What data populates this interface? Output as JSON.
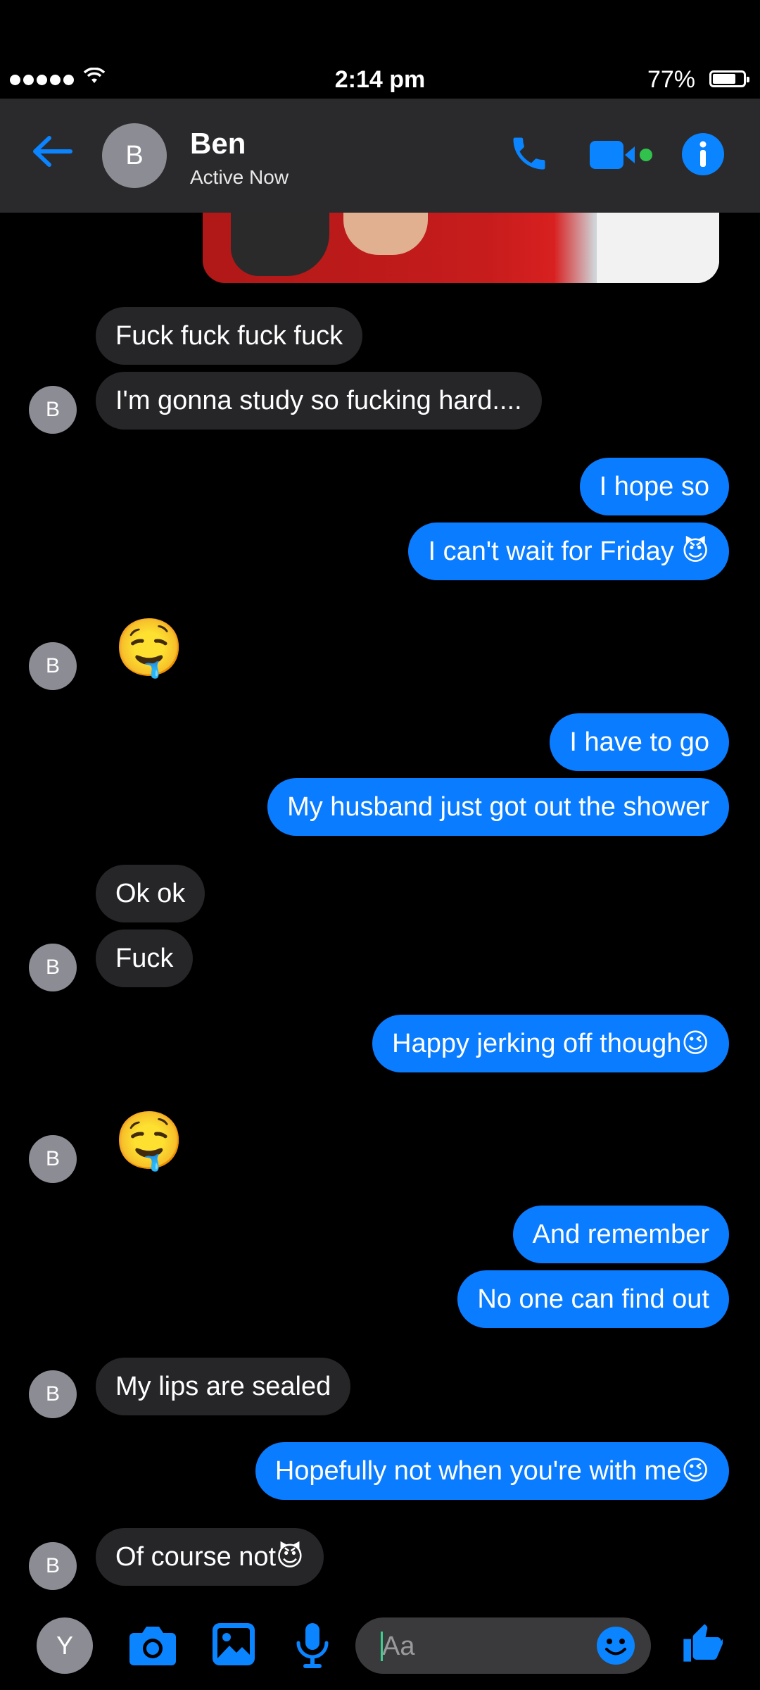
{
  "status_bar": {
    "time": "2:14 pm",
    "battery_percent": "77%",
    "battery_level": 0.77,
    "signal_bars": 5
  },
  "header": {
    "avatar_initial": "B",
    "contact_name": "Ben",
    "contact_status": "Active Now"
  },
  "colors": {
    "background": "#000000",
    "header_bg": "#2a2a2c",
    "accent_blue": "#0a7cff",
    "incoming_bubble": "#262629",
    "avatar_gray": "#8c8c94",
    "online_green": "#31c24d"
  },
  "messages": [
    {
      "from": "contact",
      "text": "Fuck fuck fuck fuck"
    },
    {
      "from": "contact",
      "text": "I'm gonna study so fucking hard...."
    },
    {
      "from": "me",
      "text": "I hope so"
    },
    {
      "from": "me",
      "text": "I can't wait for Friday 😈"
    },
    {
      "from": "contact",
      "text": "🤤"
    },
    {
      "from": "me",
      "text": "I have to go"
    },
    {
      "from": "me",
      "text": "My husband just got out the shower"
    },
    {
      "from": "contact",
      "text": "Ok ok"
    },
    {
      "from": "contact",
      "text": "Fuck"
    },
    {
      "from": "me",
      "text": "Happy jerking off though😉"
    },
    {
      "from": "contact",
      "text": "🤤"
    },
    {
      "from": "me",
      "text": "And remember"
    },
    {
      "from": "me",
      "text": "No one can find out"
    },
    {
      "from": "contact",
      "text": "My lips are sealed"
    },
    {
      "from": "me",
      "text": "Hopefully not when you're with me😉"
    },
    {
      "from": "contact",
      "text": "Of course not😈"
    }
  ],
  "contact_avatar_initial": "B",
  "composer": {
    "user_avatar_initial": "Y",
    "placeholder": "Aa",
    "icons": [
      "camera-icon",
      "gallery-icon",
      "mic-icon",
      "emoji-icon",
      "thumbs-up-icon"
    ]
  }
}
